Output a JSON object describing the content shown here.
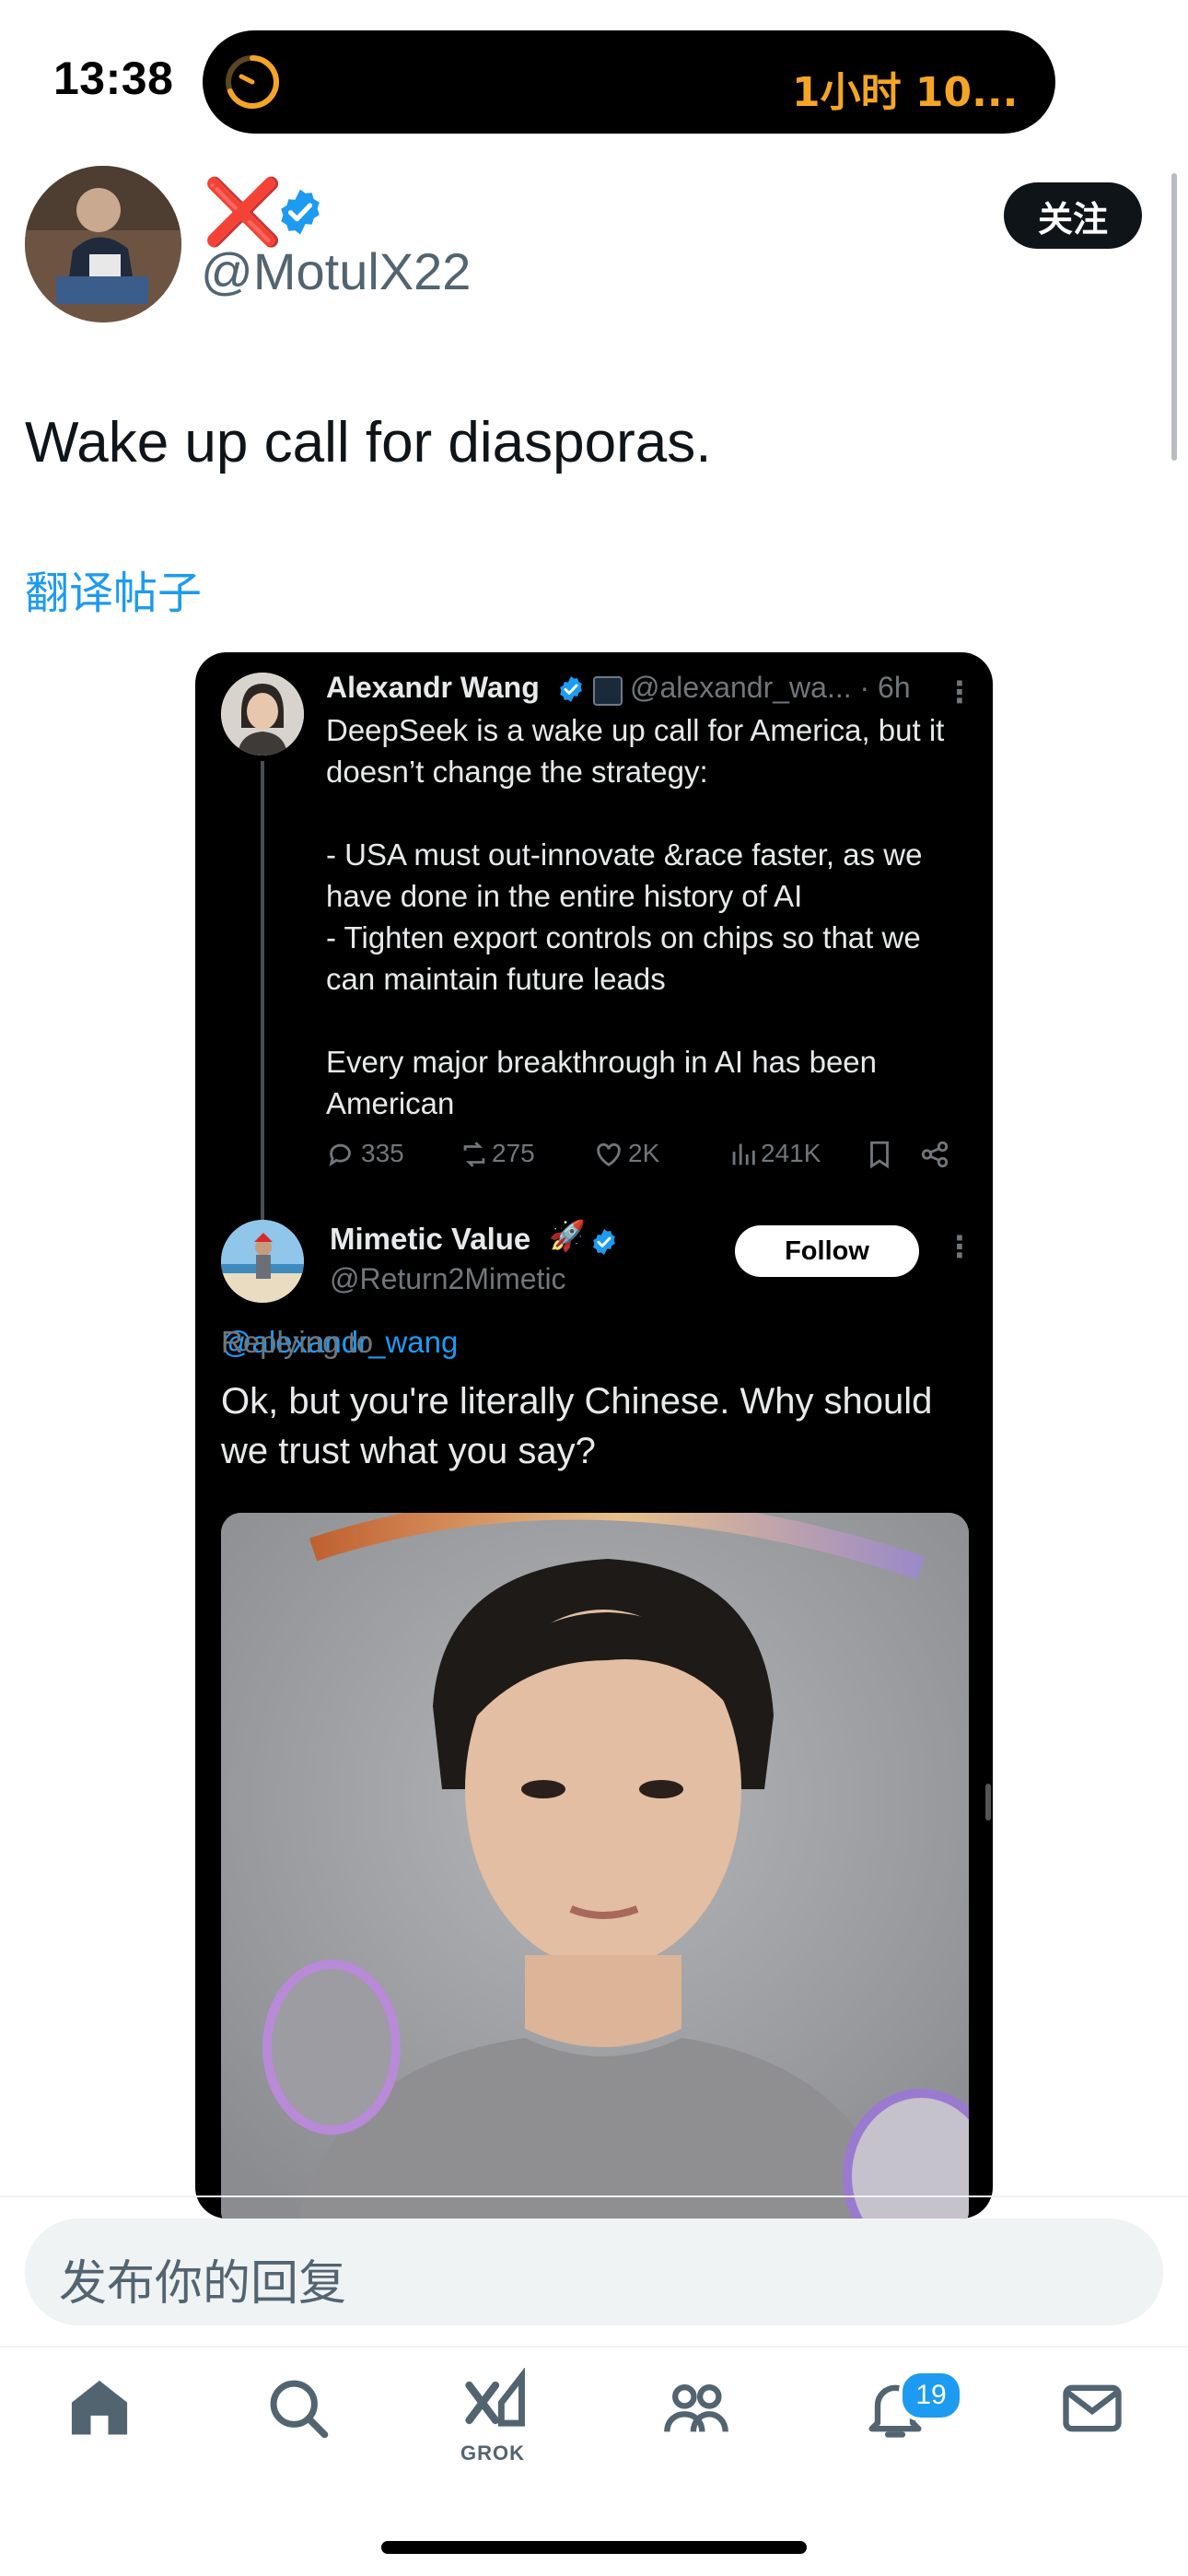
{
  "status_bar": {
    "time": "13:38",
    "island_text": "1小时 10..."
  },
  "tweet": {
    "name_mark": "❌",
    "handle": "@MotulX22",
    "follow_label": "关注",
    "text": "Wake up call for diasporas.",
    "translate_label": "翻译帖子"
  },
  "embed": {
    "original": {
      "name": "Alexandr Wang",
      "handle_time": "@alexandr_wa... · 6h",
      "text": "DeepSeek is a wake up call for America, but it doesn’t change the strategy:\n\n- USA must out-innovate &race faster, as we have done in the entire history of AI\n- Tighten export controls on chips so that we can maintain future leads\n\nEvery major breakthrough in AI has been American",
      "stats": {
        "replies": "335",
        "reposts": "275",
        "likes": "2K",
        "views": "241K"
      }
    },
    "reply": {
      "name": "Mimetic Value",
      "rocket": "🚀",
      "handle": "@Return2Mimetic",
      "follow_label": "Follow",
      "replying_prefix": "Replying to",
      "replying_handle": "@alexandr_wang",
      "text": "Ok,  but you're literally Chinese. Why should we trust what you say?"
    }
  },
  "reply_bar": {
    "placeholder": "发布你的回复"
  },
  "tab_bar": {
    "grok_label": "GROK",
    "notifications_count": "19"
  },
  "colors": {
    "accent": "#1d9bf0",
    "timer": "#f5a524",
    "error_mark": "#e0141e"
  }
}
